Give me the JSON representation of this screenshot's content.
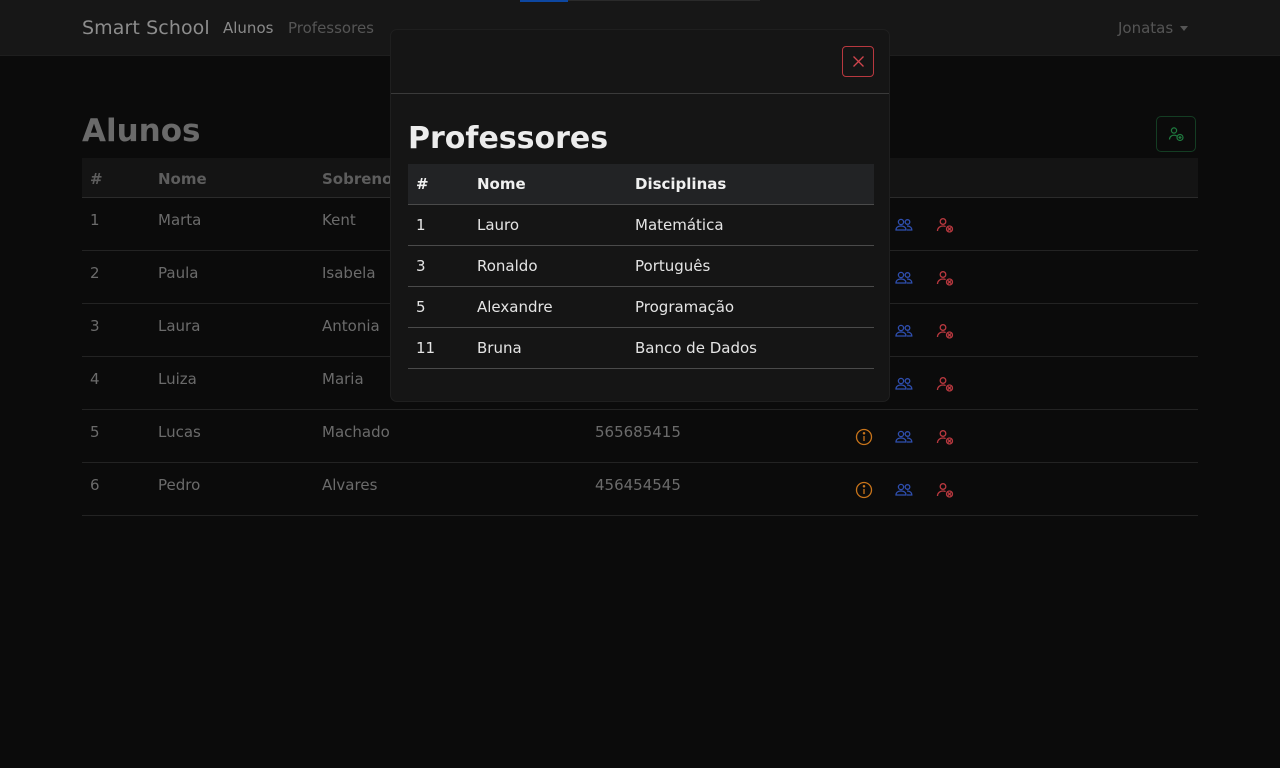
{
  "navbar": {
    "brand": "Smart School",
    "links": [
      "Alunos",
      "Professores"
    ],
    "user": "Jonatas"
  },
  "page": {
    "title": "Alunos",
    "table": {
      "headers": [
        "#",
        "Nome",
        "Sobrenome"
      ],
      "rows": [
        [
          "1",
          "Marta",
          "Kent",
          ""
        ],
        [
          "2",
          "Paula",
          "Isabela",
          ""
        ],
        [
          "3",
          "Laura",
          "Antonia",
          ""
        ],
        [
          "4",
          "Luiza",
          "Maria",
          ""
        ],
        [
          "5",
          "Lucas",
          "Machado",
          "565685415"
        ],
        [
          "6",
          "Pedro",
          "Alvares",
          "456454545"
        ]
      ]
    }
  },
  "modal": {
    "title": "Professores",
    "headers": [
      "#",
      "Nome",
      "Disciplinas"
    ],
    "rows": [
      [
        "1",
        "Lauro",
        "Matemática"
      ],
      [
        "3",
        "Ronaldo",
        "Português"
      ],
      [
        "5",
        "Alexandre",
        "Programação"
      ],
      [
        "11",
        "Bruna",
        "Banco de Dados"
      ]
    ]
  },
  "icons": {
    "close": "close-icon",
    "add_user": "add-user-icon",
    "info": "info-icon",
    "group": "people-icon",
    "remove_user": "remove-user-icon"
  },
  "colors": {
    "background": "#0b0b0b",
    "navbar": "#171717",
    "modal": "#151515",
    "danger": "#b8383f",
    "success": "#1f7a3f",
    "warning": "#c8741a",
    "primary": "#2f4fb0"
  }
}
